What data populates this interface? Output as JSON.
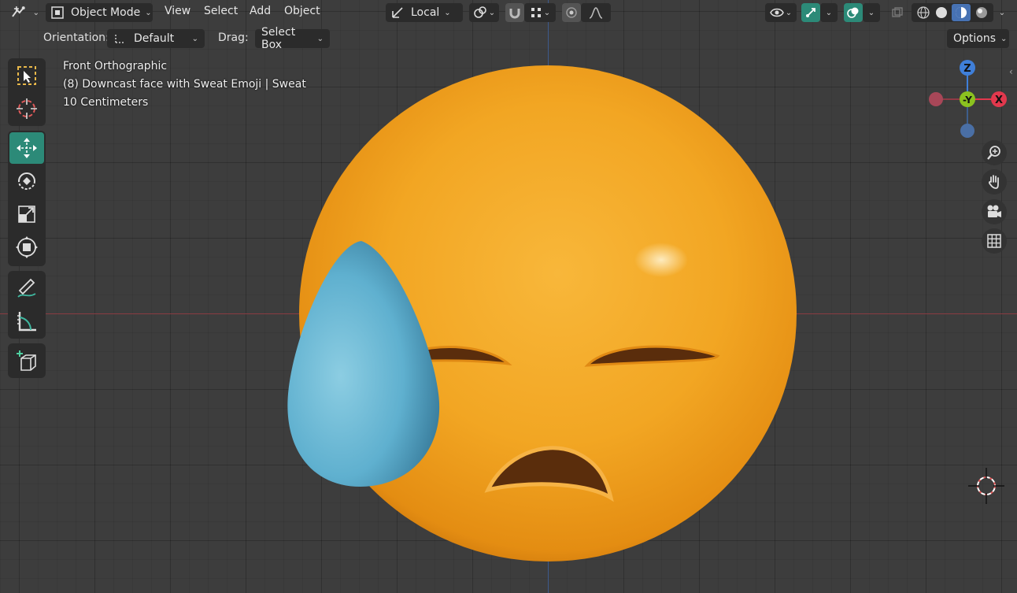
{
  "header": {
    "editor_type_icon": "editor-type-icon",
    "mode_label": "Object Mode",
    "menus": [
      "View",
      "Select",
      "Add",
      "Object"
    ],
    "transform_orientation_label": "Local",
    "snap_icon": "magnet-icon",
    "shading_modes": [
      "wireframe",
      "solid",
      "material-preview",
      "rendered"
    ]
  },
  "tool_settings": {
    "orientation_label": "Orientation:",
    "orientation_value": "Default",
    "drag_label": "Drag:",
    "drag_value": "Select Box",
    "options_label": "Options"
  },
  "viewport_info": {
    "view_name": "Front Orthographic",
    "object_name": "(8) Downcast face with Sweat Emoji | Sweat",
    "scale": "10 Centimeters"
  },
  "gizmo": {
    "z_label": "Z",
    "y_label": "-Y",
    "x_label": "X",
    "colors": {
      "z": "#3f7fd9",
      "y": "#8bc21f",
      "x": "#e2384d",
      "neg_x": "#a84758",
      "neg_z": "#4a6fa5"
    }
  },
  "toolbar": {
    "tools": [
      "select-box",
      "cursor",
      "move",
      "rotate",
      "scale",
      "transform",
      "annotate",
      "measure",
      "add-cube"
    ],
    "active_tool": "move"
  },
  "colors": {
    "accent": "#2c8a78",
    "face": "#f2a623",
    "drop": "#5fb0cf"
  }
}
